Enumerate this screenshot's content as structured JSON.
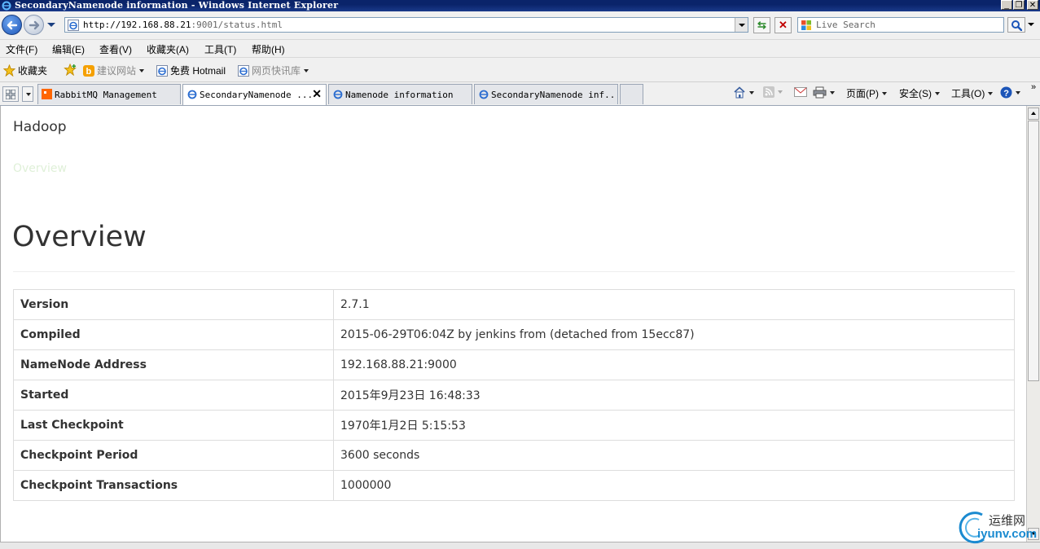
{
  "window": {
    "title": "SecondaryNamenode information - Windows Internet Explorer"
  },
  "address_bar": {
    "url_host": "http://192.168.88.21",
    "url_rest": ":9001/status.html",
    "search_placeholder": "Live Search"
  },
  "menu": {
    "items": [
      "文件(F)",
      "编辑(E)",
      "查看(V)",
      "收藏夹(A)",
      "工具(T)",
      "帮助(H)"
    ]
  },
  "favorites_bar": {
    "favorites_label": "收藏夹",
    "items": [
      "建议网站",
      "免费 Hotmail",
      "网页快讯库"
    ]
  },
  "tabs": [
    {
      "label": "RabbitMQ Management",
      "active": false
    },
    {
      "label": "SecondaryNamenode ...",
      "active": true
    },
    {
      "label": "Namenode information",
      "active": false
    },
    {
      "label": "SecondaryNamenode inf...",
      "active": false
    }
  ],
  "command_bar": {
    "page": "页面(P)",
    "safety": "安全(S)",
    "tools": "工具(O)"
  },
  "page": {
    "brand": "Hadoop",
    "nav_link": "Overview",
    "heading": "Overview",
    "rows": [
      {
        "key": "Version",
        "value": "2.7.1"
      },
      {
        "key": "Compiled",
        "value": "2015-06-29T06:04Z by jenkins from (detached from 15ecc87)"
      },
      {
        "key": "NameNode Address",
        "value": "192.168.88.21:9000"
      },
      {
        "key": "Started",
        "value": "2015年9月23日 16:48:33"
      },
      {
        "key": "Last Checkpoint",
        "value": "1970年1月2日 5:15:53"
      },
      {
        "key": "Checkpoint Period",
        "value": "3600 seconds"
      },
      {
        "key": "Checkpoint Transactions",
        "value": "1000000"
      }
    ]
  },
  "watermark": {
    "line1": "运维网",
    "line2": "iyunv.com"
  },
  "colors": {
    "title_bar": "#0a246a",
    "nav_link": "#dff0d8",
    "table_border": "#dddddd"
  }
}
